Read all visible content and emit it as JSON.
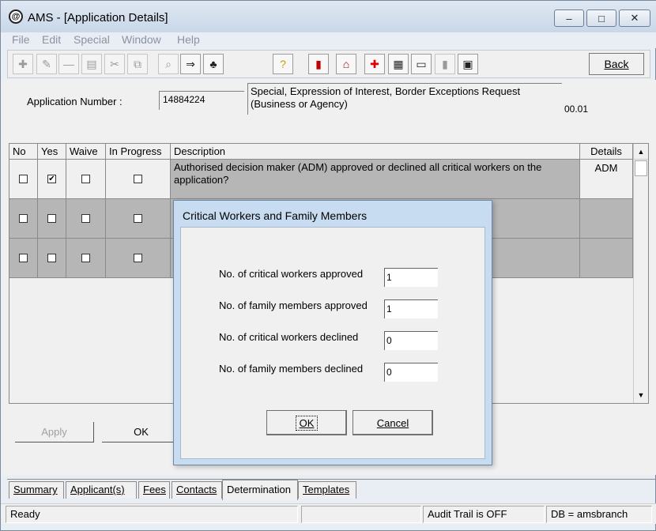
{
  "window": {
    "title": "AMS - [Application Details]"
  },
  "titlebar": {
    "minimize_glyph": "–",
    "maximize_glyph": "□",
    "close_glyph": "✕"
  },
  "menu": [
    "File",
    "Edit",
    "Special",
    "Window",
    "Help"
  ],
  "toolbar": {
    "back_label": "Back"
  },
  "application": {
    "number_label": "Application Number :",
    "number_value": "14884224",
    "type_value": "Special, Expression of Interest, Border Exceptions Request (Business or Agency)",
    "version": "00.01"
  },
  "grid": {
    "headers": [
      "No",
      "Yes",
      "Waive",
      "In Progress",
      "Description",
      "Details"
    ],
    "rows": [
      {
        "no": false,
        "yes": true,
        "waive": false,
        "in_progress": false,
        "description": "Authorised decision maker (ADM) approved or declined all critical workers on the application?",
        "details": "ADM"
      },
      {
        "no": false,
        "yes": false,
        "waive": false,
        "in_progress": false,
        "description": "",
        "details": ""
      },
      {
        "no": false,
        "yes": false,
        "waive": false,
        "in_progress": false,
        "description": "",
        "details": ""
      }
    ]
  },
  "buttons": {
    "apply": "Apply",
    "ok": "OK"
  },
  "tabs": [
    "Summary",
    "Applicant(s)",
    "Fees",
    "Contacts",
    "Determination",
    "Templates"
  ],
  "active_tab": "Determination",
  "status": {
    "left": "Ready",
    "audit": "Audit Trail is OFF",
    "db": "DB = amsbranch"
  },
  "dialog": {
    "title": "Critical Workers and Family Members",
    "fields": [
      {
        "label": "No. of critical workers approved",
        "value": "1"
      },
      {
        "label": "No. of family members approved",
        "value": "1"
      },
      {
        "label": "No. of critical workers declined",
        "value": "0"
      },
      {
        "label": "No. of family members declined",
        "value": "0"
      }
    ],
    "ok_label": "OK",
    "cancel_label": "Cancel"
  }
}
